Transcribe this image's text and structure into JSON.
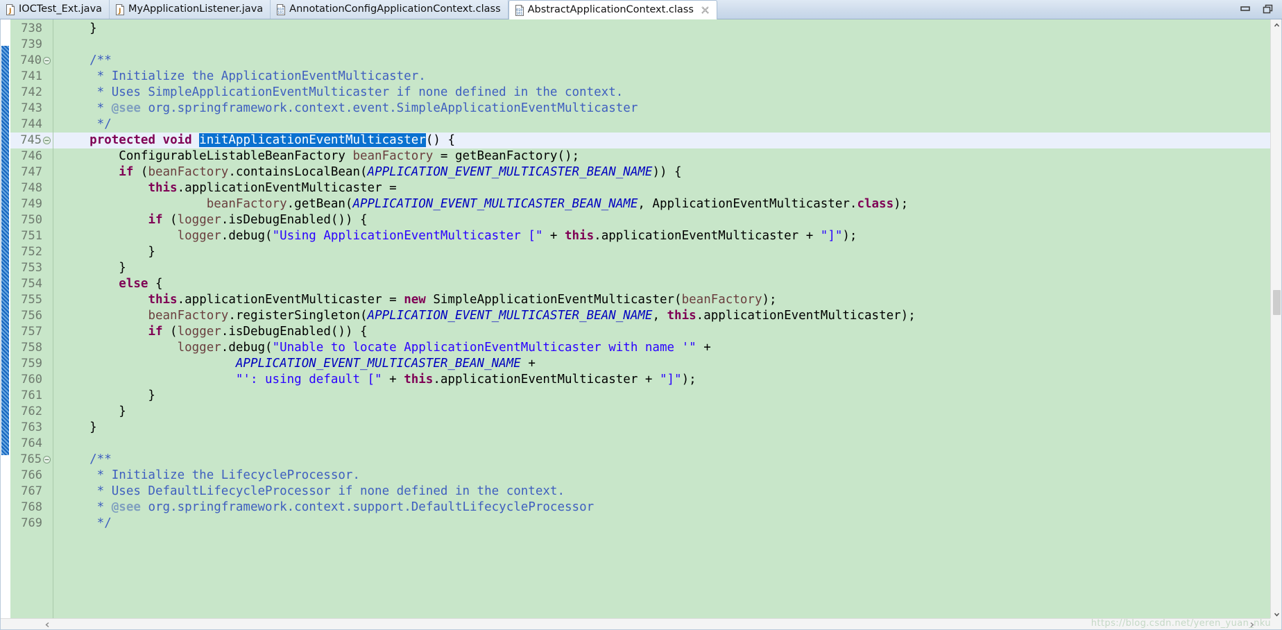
{
  "window": {
    "minimize_label": "Minimize",
    "restore_label": "Restore"
  },
  "tabs": [
    {
      "label": "IOCTest_Ext.java",
      "icon": "java-file-icon",
      "active": false,
      "closable": false
    },
    {
      "label": "MyApplicationListener.java",
      "icon": "java-file-icon",
      "active": false,
      "closable": false
    },
    {
      "label": "AnnotationConfigApplicationContext.class",
      "icon": "class-file-icon",
      "active": false,
      "closable": false
    },
    {
      "label": "AbstractApplicationContext.class",
      "icon": "class-file-icon",
      "active": true,
      "closable": true
    }
  ],
  "editor": {
    "current_line": 745,
    "selection_text": "initApplicationEventMulticaster",
    "first_visible_line": 738,
    "last_visible_line": 769,
    "background_color": "#c8e6c9",
    "current_line_color": "#eaf0fb",
    "selection_color": "#0a71d0",
    "lines": [
      {
        "n": 738,
        "fold": false,
        "tokens": [
          {
            "t": "    }",
            "c": "plain"
          }
        ]
      },
      {
        "n": 739,
        "fold": false,
        "tokens": [
          {
            "t": "",
            "c": "plain"
          }
        ]
      },
      {
        "n": 740,
        "fold": true,
        "tokens": [
          {
            "t": "    /**",
            "c": "cmt"
          }
        ]
      },
      {
        "n": 741,
        "fold": false,
        "tokens": [
          {
            "t": "     * Initialize the ApplicationEventMulticaster.",
            "c": "cmt"
          }
        ]
      },
      {
        "n": 742,
        "fold": false,
        "tokens": [
          {
            "t": "     * Uses SimpleApplicationEventMulticaster if none defined in the context.",
            "c": "cmt"
          }
        ]
      },
      {
        "n": 743,
        "fold": false,
        "tokens": [
          {
            "t": "     * ",
            "c": "cmt"
          },
          {
            "t": "@see",
            "c": "tag"
          },
          {
            "t": " org.springframework.context.event.SimpleApplicationEventMulticaster",
            "c": "cmt"
          }
        ]
      },
      {
        "n": 744,
        "fold": false,
        "tokens": [
          {
            "t": "     */",
            "c": "cmt"
          }
        ]
      },
      {
        "n": 745,
        "fold": true,
        "current": true,
        "tokens": [
          {
            "t": "    ",
            "c": "plain"
          },
          {
            "t": "protected",
            "c": "kw"
          },
          {
            "t": " ",
            "c": "plain"
          },
          {
            "t": "void",
            "c": "kw"
          },
          {
            "t": " ",
            "c": "plain"
          },
          {
            "t": "initApplicationEventMulticaster",
            "c": "sel",
            "squiggle": true
          },
          {
            "t": "() {",
            "c": "plain"
          }
        ]
      },
      {
        "n": 746,
        "fold": false,
        "tokens": [
          {
            "t": "        ConfigurableListableBeanFactory ",
            "c": "plain"
          },
          {
            "t": "beanFactory",
            "c": "lvar"
          },
          {
            "t": " = getBeanFactory();",
            "c": "plain"
          }
        ]
      },
      {
        "n": 747,
        "fold": false,
        "tokens": [
          {
            "t": "        ",
            "c": "plain"
          },
          {
            "t": "if",
            "c": "kw"
          },
          {
            "t": " (",
            "c": "plain"
          },
          {
            "t": "beanFactory",
            "c": "lvar"
          },
          {
            "t": ".containsLocalBean(",
            "c": "plain"
          },
          {
            "t": "APPLICATION_EVENT_MULTICASTER_BEAN_NAME",
            "c": "sconst"
          },
          {
            "t": ")) {",
            "c": "plain"
          }
        ]
      },
      {
        "n": 748,
        "fold": false,
        "tokens": [
          {
            "t": "            ",
            "c": "plain"
          },
          {
            "t": "this",
            "c": "kw"
          },
          {
            "t": ".applicationEventMulticaster =",
            "c": "plain"
          }
        ]
      },
      {
        "n": 749,
        "fold": false,
        "tokens": [
          {
            "t": "                    ",
            "c": "plain"
          },
          {
            "t": "beanFactory",
            "c": "lvar"
          },
          {
            "t": ".getBean(",
            "c": "plain"
          },
          {
            "t": "APPLICATION_EVENT_MULTICASTER_BEAN_NAME",
            "c": "sconst"
          },
          {
            "t": ", ApplicationEventMulticaster.",
            "c": "plain"
          },
          {
            "t": "class",
            "c": "kw"
          },
          {
            "t": ");",
            "c": "plain"
          }
        ]
      },
      {
        "n": 750,
        "fold": false,
        "tokens": [
          {
            "t": "            ",
            "c": "plain"
          },
          {
            "t": "if",
            "c": "kw"
          },
          {
            "t": " (",
            "c": "plain"
          },
          {
            "t": "logger",
            "c": "lvar"
          },
          {
            "t": ".isDebugEnabled()) {",
            "c": "plain"
          }
        ]
      },
      {
        "n": 751,
        "fold": false,
        "tokens": [
          {
            "t": "                ",
            "c": "plain"
          },
          {
            "t": "logger",
            "c": "lvar"
          },
          {
            "t": ".debug(",
            "c": "plain"
          },
          {
            "t": "\"Using ApplicationEventMulticaster [\"",
            "c": "str"
          },
          {
            "t": " + ",
            "c": "plain"
          },
          {
            "t": "this",
            "c": "kw"
          },
          {
            "t": ".applicationEventMulticaster + ",
            "c": "plain"
          },
          {
            "t": "\"]\"",
            "c": "str"
          },
          {
            "t": ");",
            "c": "plain"
          }
        ]
      },
      {
        "n": 752,
        "fold": false,
        "tokens": [
          {
            "t": "            }",
            "c": "plain"
          }
        ]
      },
      {
        "n": 753,
        "fold": false,
        "tokens": [
          {
            "t": "        }",
            "c": "plain"
          }
        ]
      },
      {
        "n": 754,
        "fold": false,
        "tokens": [
          {
            "t": "        ",
            "c": "plain"
          },
          {
            "t": "else",
            "c": "kw"
          },
          {
            "t": " {",
            "c": "plain"
          }
        ]
      },
      {
        "n": 755,
        "fold": false,
        "tokens": [
          {
            "t": "            ",
            "c": "plain"
          },
          {
            "t": "this",
            "c": "kw"
          },
          {
            "t": ".applicationEventMulticaster = ",
            "c": "plain"
          },
          {
            "t": "new",
            "c": "kw"
          },
          {
            "t": " SimpleApplicationEventMulticaster(",
            "c": "plain"
          },
          {
            "t": "beanFactory",
            "c": "lvar"
          },
          {
            "t": ");",
            "c": "plain"
          }
        ]
      },
      {
        "n": 756,
        "fold": false,
        "tokens": [
          {
            "t": "            ",
            "c": "plain"
          },
          {
            "t": "beanFactory",
            "c": "lvar"
          },
          {
            "t": ".registerSingleton(",
            "c": "plain"
          },
          {
            "t": "APPLICATION_EVENT_MULTICASTER_BEAN_NAME",
            "c": "sconst"
          },
          {
            "t": ", ",
            "c": "plain"
          },
          {
            "t": "this",
            "c": "kw"
          },
          {
            "t": ".applicationEventMulticaster);",
            "c": "plain"
          }
        ]
      },
      {
        "n": 757,
        "fold": false,
        "tokens": [
          {
            "t": "            ",
            "c": "plain"
          },
          {
            "t": "if",
            "c": "kw"
          },
          {
            "t": " (",
            "c": "plain"
          },
          {
            "t": "logger",
            "c": "lvar"
          },
          {
            "t": ".isDebugEnabled()) {",
            "c": "plain"
          }
        ]
      },
      {
        "n": 758,
        "fold": false,
        "tokens": [
          {
            "t": "                ",
            "c": "plain"
          },
          {
            "t": "logger",
            "c": "lvar"
          },
          {
            "t": ".debug(",
            "c": "plain"
          },
          {
            "t": "\"Unable to locate ApplicationEventMulticaster with name '\"",
            "c": "str"
          },
          {
            "t": " +",
            "c": "plain"
          }
        ]
      },
      {
        "n": 759,
        "fold": false,
        "tokens": [
          {
            "t": "                        ",
            "c": "plain"
          },
          {
            "t": "APPLICATION_EVENT_MULTICASTER_BEAN_NAME",
            "c": "sconst"
          },
          {
            "t": " +",
            "c": "plain"
          }
        ]
      },
      {
        "n": 760,
        "fold": false,
        "tokens": [
          {
            "t": "                        ",
            "c": "plain"
          },
          {
            "t": "\"': using default [\"",
            "c": "str"
          },
          {
            "t": " + ",
            "c": "plain"
          },
          {
            "t": "this",
            "c": "kw"
          },
          {
            "t": ".applicationEventMulticaster + ",
            "c": "plain"
          },
          {
            "t": "\"]\"",
            "c": "str"
          },
          {
            "t": ");",
            "c": "plain"
          }
        ]
      },
      {
        "n": 761,
        "fold": false,
        "tokens": [
          {
            "t": "            }",
            "c": "plain"
          }
        ]
      },
      {
        "n": 762,
        "fold": false,
        "tokens": [
          {
            "t": "        }",
            "c": "plain"
          }
        ]
      },
      {
        "n": 763,
        "fold": false,
        "tokens": [
          {
            "t": "    }",
            "c": "plain"
          }
        ]
      },
      {
        "n": 764,
        "fold": false,
        "tokens": [
          {
            "t": "",
            "c": "plain"
          }
        ]
      },
      {
        "n": 765,
        "fold": true,
        "tokens": [
          {
            "t": "    /**",
            "c": "cmt"
          }
        ]
      },
      {
        "n": 766,
        "fold": false,
        "tokens": [
          {
            "t": "     * Initialize the LifecycleProcessor.",
            "c": "cmt"
          }
        ]
      },
      {
        "n": 767,
        "fold": false,
        "tokens": [
          {
            "t": "     * Uses DefaultLifecycleProcessor if none defined in the context.",
            "c": "cmt"
          }
        ]
      },
      {
        "n": 768,
        "fold": false,
        "tokens": [
          {
            "t": "     * ",
            "c": "cmt"
          },
          {
            "t": "@see",
            "c": "tag"
          },
          {
            "t": " org.springframework.context.support.DefaultLifecycleProcessor",
            "c": "cmt"
          }
        ]
      },
      {
        "n": 769,
        "fold": false,
        "tokens": [
          {
            "t": "     */",
            "c": "cmt"
          }
        ]
      }
    ]
  },
  "watermark": {
    "text": "https://blog.csdn.net/yeren_yuan_nku"
  }
}
